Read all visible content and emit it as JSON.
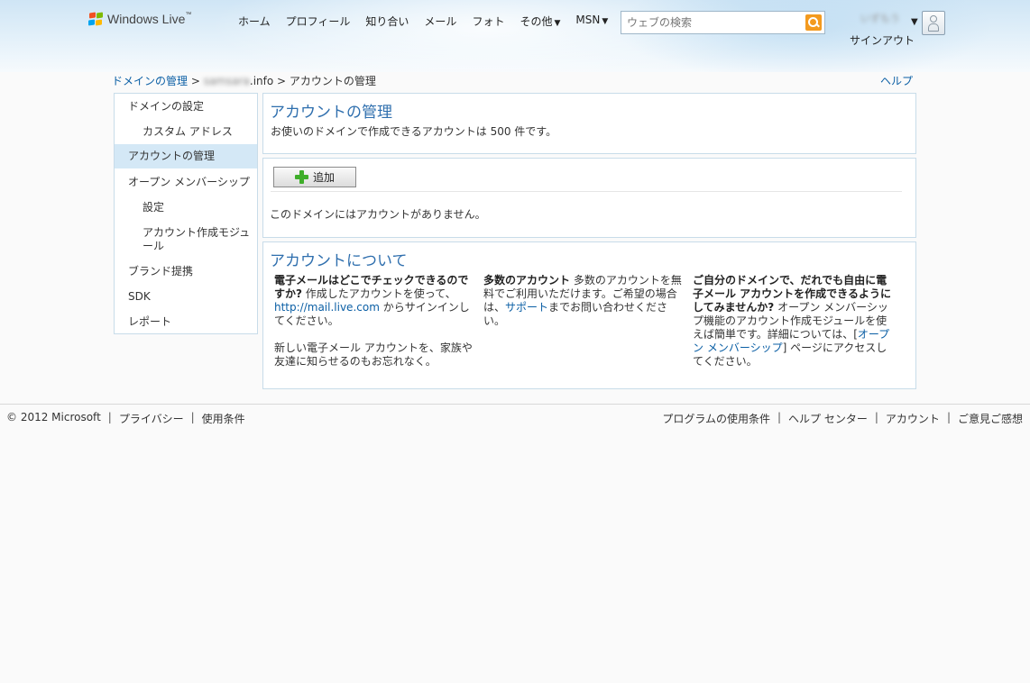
{
  "header": {
    "logo_text": "Windows Live",
    "logo_tm": "™",
    "nav": [
      {
        "label": "ホーム",
        "has_caret": false
      },
      {
        "label": "プロフィール",
        "has_caret": false
      },
      {
        "label": "知り合い",
        "has_caret": false
      },
      {
        "label": "メール",
        "has_caret": false
      },
      {
        "label": "フォト",
        "has_caret": false
      },
      {
        "label": "その他",
        "has_caret": true
      },
      {
        "label": "MSN",
        "has_caret": true
      }
    ],
    "caret_glyph": "▼",
    "search_placeholder": "ウェブの検索",
    "search_icon": "magnifier-icon",
    "user_name": "いずもう",
    "signout_label": "サインアウト",
    "avatar_icon": "user-avatar-icon"
  },
  "breadcrumb": {
    "root": "ドメインの管理",
    "sep": " > ",
    "domain_blurred": "samsara",
    "domain_suffix": ".info",
    "current": "アカウントの管理"
  },
  "help_label": "ヘルプ",
  "sidebar": {
    "items": [
      {
        "label": "ドメインの設定",
        "indent": false,
        "active": false
      },
      {
        "label": "カスタム アドレス",
        "indent": true,
        "active": false
      },
      {
        "label": "アカウントの管理",
        "indent": false,
        "active": true
      },
      {
        "label": "オープン メンバーシップ",
        "indent": false,
        "active": false
      },
      {
        "label": "設定",
        "indent": true,
        "active": false
      },
      {
        "label": "アカウント作成モジュール",
        "indent": true,
        "active": false
      },
      {
        "label": "ブランド提携",
        "indent": false,
        "active": false
      },
      {
        "label": "SDK",
        "indent": false,
        "active": false
      },
      {
        "label": "レポート",
        "indent": false,
        "active": false
      }
    ]
  },
  "accounts_panel": {
    "title": "アカウントの管理",
    "description": "お使いのドメインで作成できるアカウントは 500 件です。"
  },
  "list_panel": {
    "add_label": "追加",
    "empty_message": "このドメインにはアカウントがありません。"
  },
  "about_panel": {
    "title": "アカウントについて",
    "col1": {
      "heading": "電子メールはどこでチェックできるのですか?",
      "text1": " 作成したアカウントを使って、",
      "link": "http://mail.live.com",
      "text2": " からサインインしてください。",
      "text3": "新しい電子メール アカウントを、家族や友達に知らせるのもお忘れなく。"
    },
    "col2": {
      "heading": "多数のアカウント",
      "text1": " 多数のアカウントを無料でご利用いただけます。ご希望の場合は、",
      "link": "サポート",
      "text2": "までお問い合わせください。"
    },
    "col3": {
      "heading": "ご自分のドメインで、だれでも自由に電子メール アカウントを作成できるようにしてみませんか?",
      "text1": " オープン メンバーシップ機能のアカウント作成モジュールを使えば簡単です。詳細については、[",
      "link": "オープン メンバーシップ",
      "text2": "] ページにアクセスしてください。"
    }
  },
  "footer": {
    "left": [
      "© 2012 Microsoft",
      "プライバシー",
      "使用条件"
    ],
    "right": [
      "プログラムの使用条件",
      "ヘルプ センター",
      "アカウント",
      "ご意見ご感想"
    ],
    "separator": "|"
  }
}
